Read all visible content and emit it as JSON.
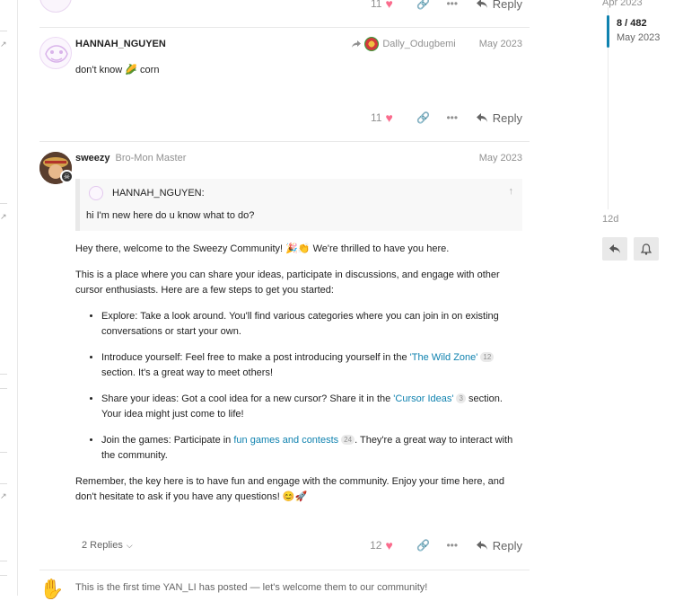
{
  "top_post": {
    "like_count": "11",
    "reply_label": "Reply"
  },
  "post1": {
    "username": "HANNAH_NGUYEN",
    "reply_to_user": "Dally_Odugbemi",
    "date": "May 2023",
    "text": "don't know 🌽 corn",
    "like_count": "11",
    "reply_label": "Reply"
  },
  "post2": {
    "username": "sweezy",
    "user_title": "Bro-Mon Master",
    "date": "May 2023",
    "quote": {
      "author": "HANNAH_NGUYEN:",
      "text": "hi I'm new here do u know what to do?"
    },
    "intro": "Hey there, welcome to the Sweezy Community! 🎉👏 We're thrilled to have you here.",
    "para2": "This is a place where you can share your ideas, participate in discussions, and engage with other cursor enthusiasts. Here are a few steps to get you started:",
    "bullets": [
      {
        "before": "Explore: Take a look around. You'll find various categories where you can join in on existing conversations or start your own.",
        "link": "",
        "count": "",
        "after": ""
      },
      {
        "before": "Introduce yourself: Feel free to make a post introducing yourself in the ",
        "link": "'The Wild Zone'",
        "count": "12",
        "after": " section. It's a great way to meet others!"
      },
      {
        "before": "Share your ideas: Got a cool idea for a new cursor? Share it in the ",
        "link": "'Cursor Ideas'",
        "count": "3",
        "after": " section. Your idea might just come to life!"
      },
      {
        "before": "Join the games: Participate in ",
        "link": "fun games and contests",
        "count": "24",
        "after": ". They're a great way to interact with the community."
      }
    ],
    "closing": "Remember, the key here is to have fun and engage with the community. Enjoy your time here, and don't hesitate to ask if you have any questions! 😊🚀",
    "replies_label": "2 Replies",
    "like_count": "12",
    "reply_label": "Reply"
  },
  "notice": {
    "text": "This is the first time YAN_LI has posted — let's welcome them to our community!"
  },
  "timeline": {
    "top_date": "Apr 2023",
    "position": "8 / 482",
    "position_date": "May 2023",
    "end_label": "12d"
  },
  "colors": {
    "link": "#0f82af",
    "heart": "#fa6c8d",
    "muted": "#919191"
  }
}
